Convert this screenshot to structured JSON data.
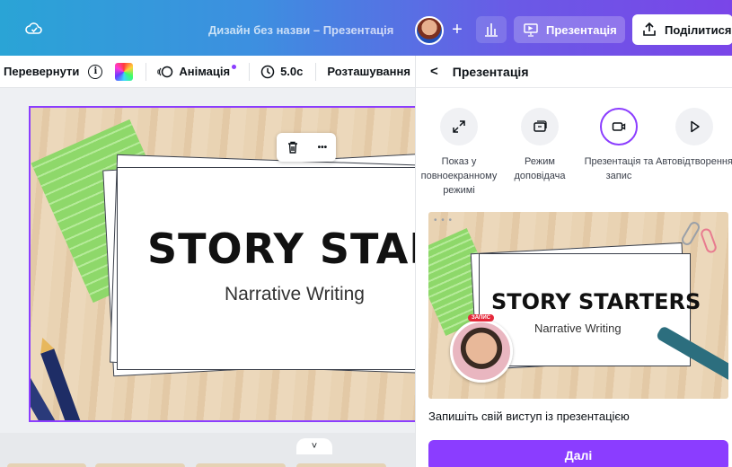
{
  "header": {
    "doc_title": "Дизайн без назви – Презентація",
    "plus": "+",
    "present_label": "Презентація",
    "share_label": "Поділитися"
  },
  "toolbar": {
    "flip_label": "Перевернути",
    "info_glyph": "i",
    "animation_label": "Анімація",
    "duration_label": "5.0с",
    "position_label": "Розташування"
  },
  "canvas": {
    "title": "STORY STARTE",
    "subtitle": "Narrative Writing",
    "more_glyph": "•••",
    "expand_glyph": "˅"
  },
  "panel": {
    "back_glyph": "<",
    "title": "Презентація",
    "options": [
      {
        "icon": "fullscreen-icon",
        "label": "Показ у повноекранному режимі"
      },
      {
        "icon": "presenter-icon",
        "label": "Режим доповідача"
      },
      {
        "icon": "camera-icon",
        "label": "Презентація та запис",
        "active": true
      },
      {
        "icon": "play-icon",
        "label": "Автовідтворення"
      }
    ],
    "preview": {
      "dots": "• • •",
      "title": "STORY STARTERS",
      "subtitle": "Narrative Writing",
      "rec_badge": "ЗАПИС"
    },
    "caption": "Запишіть свій виступ із презентацією",
    "next_label": "Далі"
  },
  "colors": {
    "accent": "#8b3dff",
    "slide_green": "#8ed86a",
    "record_red": "#e5283a"
  }
}
